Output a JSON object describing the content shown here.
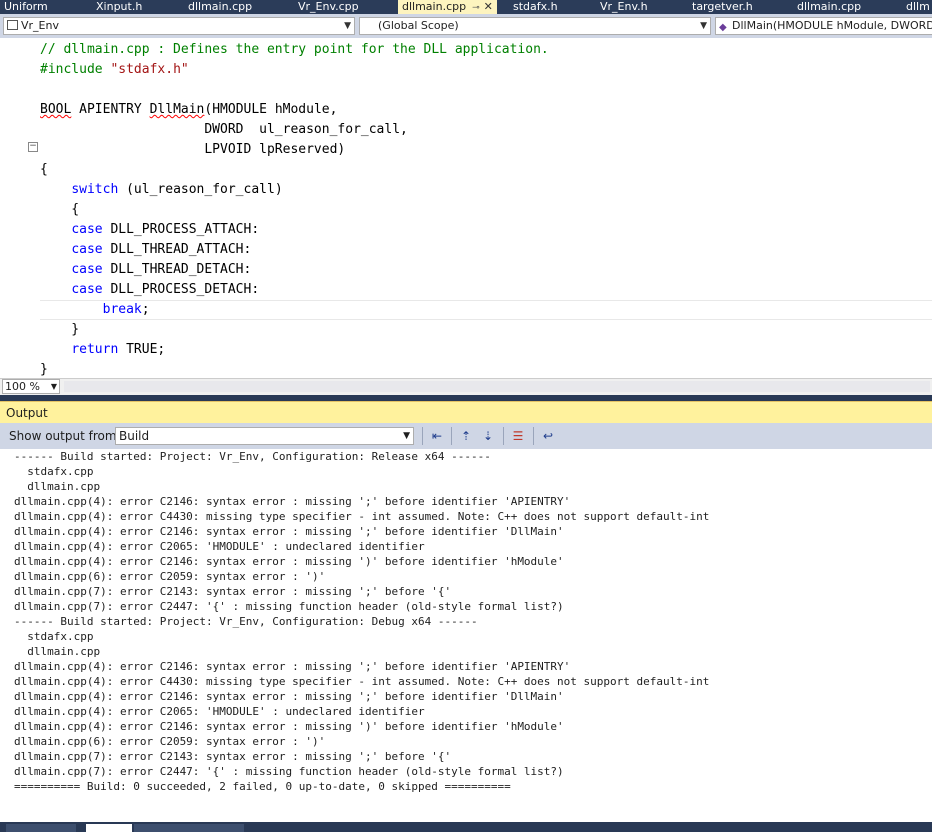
{
  "tabs": [
    {
      "label": "Uniform",
      "active": false
    },
    {
      "label": "Xinput.h",
      "active": false
    },
    {
      "label": "dllmain.cpp",
      "active": false
    },
    {
      "label": "Vr_Env.cpp",
      "active": false
    },
    {
      "label": "dllmain.cpp",
      "active": true
    },
    {
      "label": "stdafx.h",
      "active": false
    },
    {
      "label": "Vr_Env.h",
      "active": false
    },
    {
      "label": "targetver.h",
      "active": false
    },
    {
      "label": "dllmain.cpp",
      "active": false
    },
    {
      "label": "dllm",
      "active": false
    }
  ],
  "tab_icons": {
    "pin": "pin-icon",
    "close": "close-icon"
  },
  "navbar": {
    "project": "Vr_Env",
    "scope": "(Global Scope)",
    "member": "DllMain(HMODULE hModule, DWORD"
  },
  "code_lines": [
    "// dllmain.cpp : Defines the entry point for the DLL application.",
    "#include \"stdafx.h\"",
    "",
    "BOOL APIENTRY DllMain(HMODULE hModule,",
    "                     DWORD  ul_reason_for_call,",
    "                     LPVOID lpReserved)",
    "{",
    "    switch (ul_reason_for_call)",
    "    {",
    "    case DLL_PROCESS_ATTACH:",
    "    case DLL_THREAD_ATTACH:",
    "    case DLL_THREAD_DETACH:",
    "    case DLL_PROCESS_DETACH:",
    "        break;",
    "    }",
    "    return TRUE;",
    "}"
  ],
  "zoom": "100 %",
  "output": {
    "title": "Output",
    "show_from_label": "Show output from:",
    "source": "Build",
    "lines": [
      "------ Build started: Project: Vr_Env, Configuration: Release x64 ------",
      "  stdafx.cpp",
      "  dllmain.cpp",
      "dllmain.cpp(4): error C2146: syntax error : missing ';' before identifier 'APIENTRY'",
      "dllmain.cpp(4): error C4430: missing type specifier - int assumed. Note: C++ does not support default-int",
      "dllmain.cpp(4): error C2146: syntax error : missing ';' before identifier 'DllMain'",
      "dllmain.cpp(4): error C2065: 'HMODULE' : undeclared identifier",
      "dllmain.cpp(4): error C2146: syntax error : missing ')' before identifier 'hModule'",
      "dllmain.cpp(6): error C2059: syntax error : ')'",
      "dllmain.cpp(7): error C2143: syntax error : missing ';' before '{'",
      "dllmain.cpp(7): error C2447: '{' : missing function header (old-style formal list?)",
      "------ Build started: Project: Vr_Env, Configuration: Debug x64 ------",
      "  stdafx.cpp",
      "  dllmain.cpp",
      "dllmain.cpp(4): error C2146: syntax error : missing ';' before identifier 'APIENTRY'",
      "dllmain.cpp(4): error C4430: missing type specifier - int assumed. Note: C++ does not support default-int",
      "dllmain.cpp(4): error C2146: syntax error : missing ';' before identifier 'DllMain'",
      "dllmain.cpp(4): error C2065: 'HMODULE' : undeclared identifier",
      "dllmain.cpp(4): error C2146: syntax error : missing ')' before identifier 'hModule'",
      "dllmain.cpp(6): error C2059: syntax error : ')'",
      "dllmain.cpp(7): error C2143: syntax error : missing ';' before '{'",
      "dllmain.cpp(7): error C2447: '{' : missing function header (old-style formal list?)",
      "========== Build: 0 succeeded, 2 failed, 0 up-to-date, 0 skipped =========="
    ]
  },
  "colors": {
    "tab_bar": "#2b3c59",
    "active_tab": "#fdf4bf",
    "output_header": "#fff29d",
    "comment": "#008000",
    "keyword": "#0000ff",
    "string": "#a31515"
  }
}
